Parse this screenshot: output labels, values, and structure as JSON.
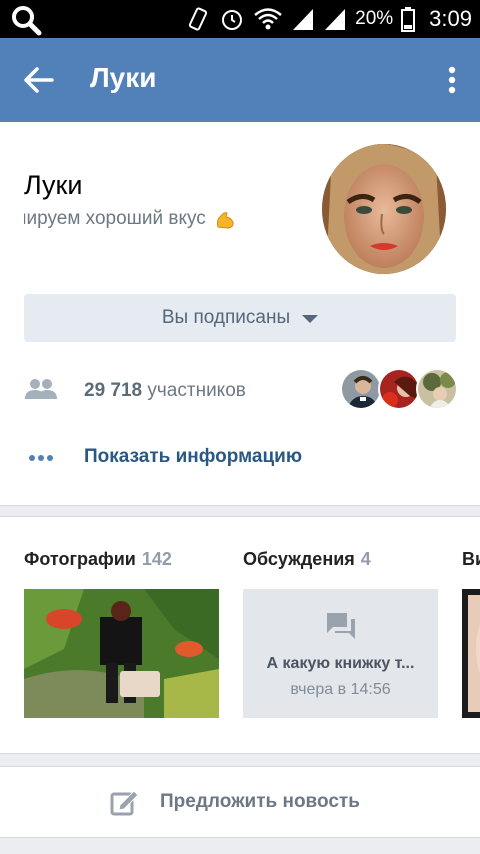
{
  "status_bar": {
    "battery_percent": "20%",
    "time": "3:09"
  },
  "header": {
    "title": "Луки"
  },
  "profile": {
    "name": "Луки",
    "status": "нируем хороший вкус",
    "subscribe_button": "Вы подписаны",
    "members_count": "29 718",
    "members_label": "участников",
    "show_info": "Показать информацию"
  },
  "sections": {
    "photos": {
      "title": "Фотографии",
      "count": "142"
    },
    "discussions": {
      "title": "Обсуждения",
      "count": "4",
      "topic_title": "А какую книжку т...",
      "topic_date": "вчера в 14:56"
    },
    "video": {
      "title": "Ви"
    }
  },
  "suggest": {
    "label": "Предложить новость"
  },
  "colors": {
    "header_bg": "#5181b8",
    "link": "#2a5885",
    "muted": "#6d7885"
  }
}
